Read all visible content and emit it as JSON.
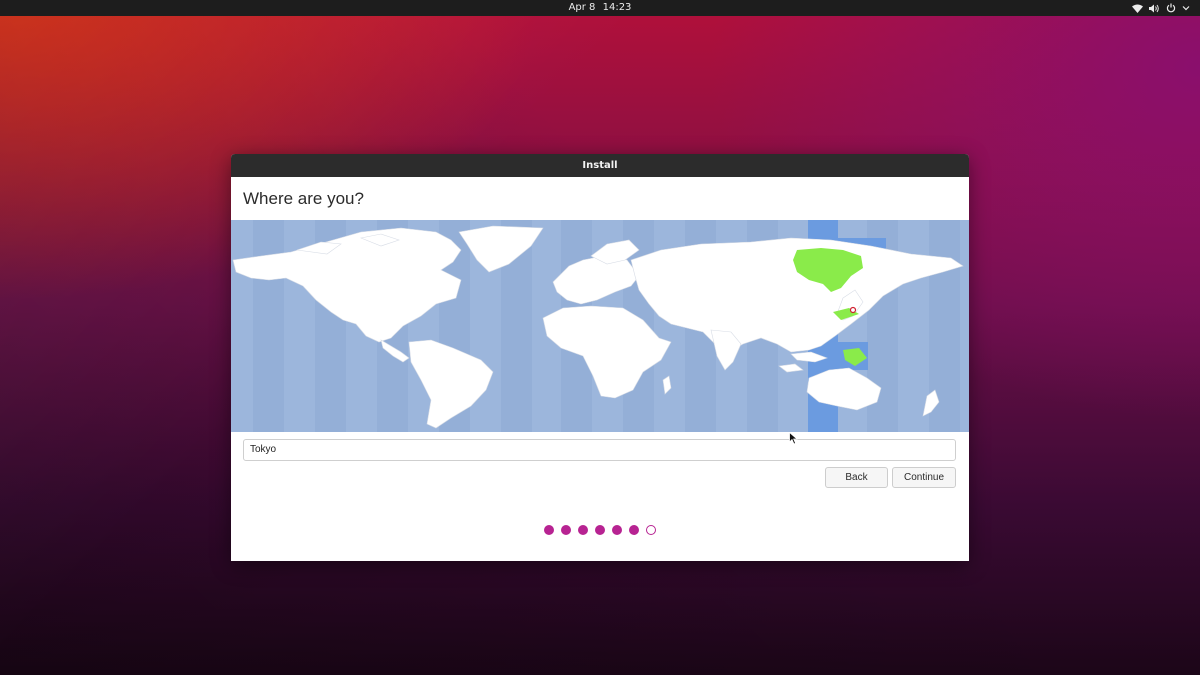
{
  "topbar": {
    "date": "Apr 8",
    "time": "14:23",
    "tray_icons": [
      "wifi-icon",
      "volume-icon",
      "power-icon",
      "chevron-down-icon"
    ]
  },
  "window": {
    "title": "Install",
    "heading": "Where are you?",
    "timezone_value": "Tokyo",
    "back_label": "Back",
    "continue_label": "Continue",
    "progress": {
      "total_steps": 7,
      "completed_steps": 6
    }
  },
  "colors": {
    "accent": "#b72392",
    "map_ocean": "#9cb6dc",
    "map_selected_zone": "#6b9be0",
    "map_highlight": "#8aeb4a",
    "titlebar": "#2c2c2c"
  }
}
